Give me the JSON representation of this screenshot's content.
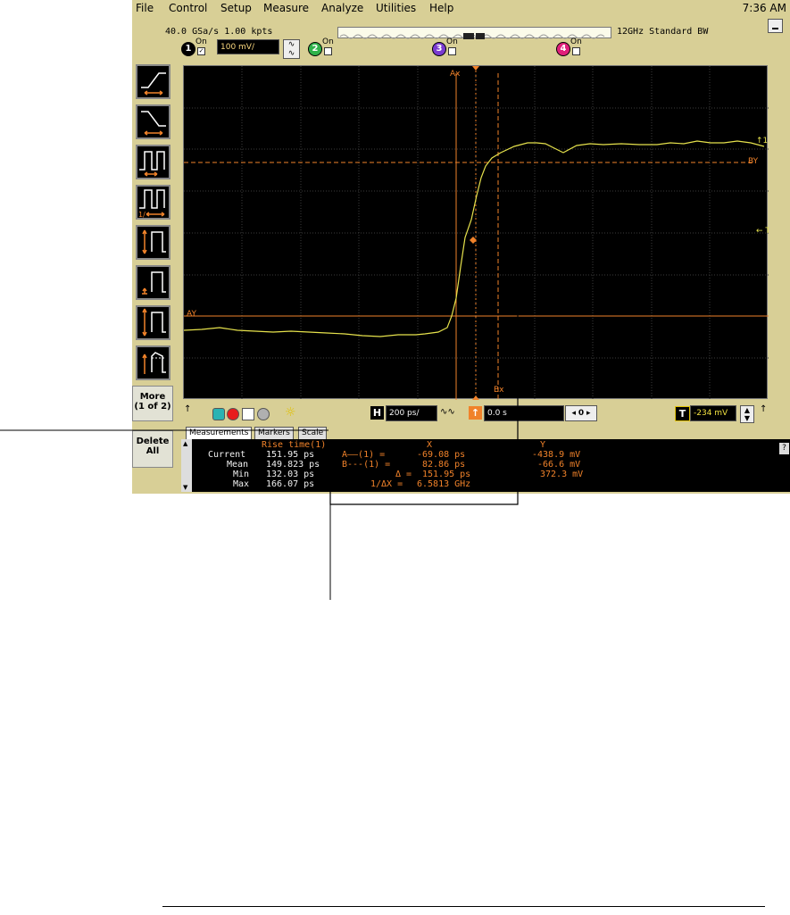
{
  "menu": [
    "File",
    "Control",
    "Setup",
    "Measure",
    "Analyze",
    "Utilities",
    "Help"
  ],
  "clock": "7:36 AM",
  "acquisition": "40.0 GSa/s  1.00 kpts",
  "bandwidth": "12GHz Standard BW",
  "channels": [
    {
      "num": "1",
      "on_label": "On",
      "checked": true,
      "scale": "100 mV/",
      "color": "#f2e94a"
    },
    {
      "num": "2",
      "on_label": "On",
      "checked": false,
      "color": "#2fb24a"
    },
    {
      "num": "3",
      "on_label": "On",
      "checked": false,
      "color": "#7a3bd0"
    },
    {
      "num": "4",
      "on_label": "On",
      "checked": false,
      "color": "#e0207a"
    }
  ],
  "toolbar": {
    "more_line1": "More",
    "more_line2": "(1 of 2)",
    "delete_line1": "Delete",
    "delete_line2": "All"
  },
  "markers": {
    "ax": "Ax",
    "bx": "Bx",
    "ay": "AY",
    "by": "BY"
  },
  "controls": {
    "h_letter": "H",
    "time_scale": "200 ps/",
    "delay": "0.0 s",
    "delay_btn": "0",
    "t_letter": "T",
    "trigger_level": "-234 mV"
  },
  "tabs": [
    "Measurements",
    "Markers",
    "Scale"
  ],
  "measurements": {
    "title": "Rise time(1)",
    "rows": [
      {
        "label": "Current",
        "value": "151.95 ps"
      },
      {
        "label": "Mean",
        "value": "149.823 ps"
      },
      {
        "label": "Min",
        "value": "132.03 ps"
      },
      {
        "label": "Max",
        "value": "166.07 ps"
      }
    ],
    "marker_head_x": "X",
    "marker_head_y": "Y",
    "marker_rows": [
      {
        "label": "A——(1) =",
        "x": "-69.08 ps",
        "y": "-438.9 mV"
      },
      {
        "label": "B---(1) =",
        "x": "82.86 ps",
        "y": "-66.6 mV"
      },
      {
        "label": "Δ =",
        "x": "151.95 ps",
        "y": "372.3 mV"
      },
      {
        "label": "1/ΔX =",
        "x": "6.5813 GHz",
        "y": ""
      }
    ],
    "help": "?"
  },
  "colors": {
    "frame": "#d8cf96",
    "trace": "#e6e24c",
    "marker": "#f0822a",
    "grid": "#4a4a4a"
  }
}
